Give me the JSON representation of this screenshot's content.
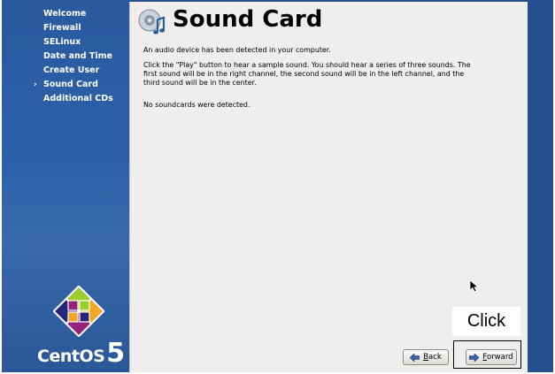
{
  "sidebar": {
    "items": [
      {
        "label": "Welcome",
        "current": false
      },
      {
        "label": "Firewall",
        "current": false
      },
      {
        "label": "SELinux",
        "current": false
      },
      {
        "label": "Date and Time",
        "current": false
      },
      {
        "label": "Create User",
        "current": false
      },
      {
        "label": "Sound Card",
        "current": true
      },
      {
        "label": "Additional CDs",
        "current": false
      }
    ],
    "current_marker": "›"
  },
  "logo": {
    "word": "CentOS",
    "number": "5"
  },
  "page": {
    "title": "Sound Card",
    "intro": "An audio device has been detected in your computer.",
    "instructions": "Click the \"Play\" button to hear a sample sound.  You should hear a series of three sounds.  The first sound will be in the right channel, the second sound will be in the left channel, and the third sound will be in the center.",
    "status": "No soundcards were detected."
  },
  "buttons": {
    "back": {
      "mnemonic": "B",
      "rest": "ack"
    },
    "forward": {
      "mnemonic": "F",
      "rest": "orward"
    }
  },
  "annotation": {
    "label": "Click"
  },
  "colors": {
    "sidebar_bg": "#2b60a8",
    "frame_bg": "#25508f",
    "content_bg": "#efeeec",
    "nav_text": "#ffffff"
  },
  "icons": [
    "sound-card-icon",
    "back-arrow-icon",
    "forward-arrow-icon",
    "mouse-pointer-icon",
    "centos-logo-icon"
  ]
}
